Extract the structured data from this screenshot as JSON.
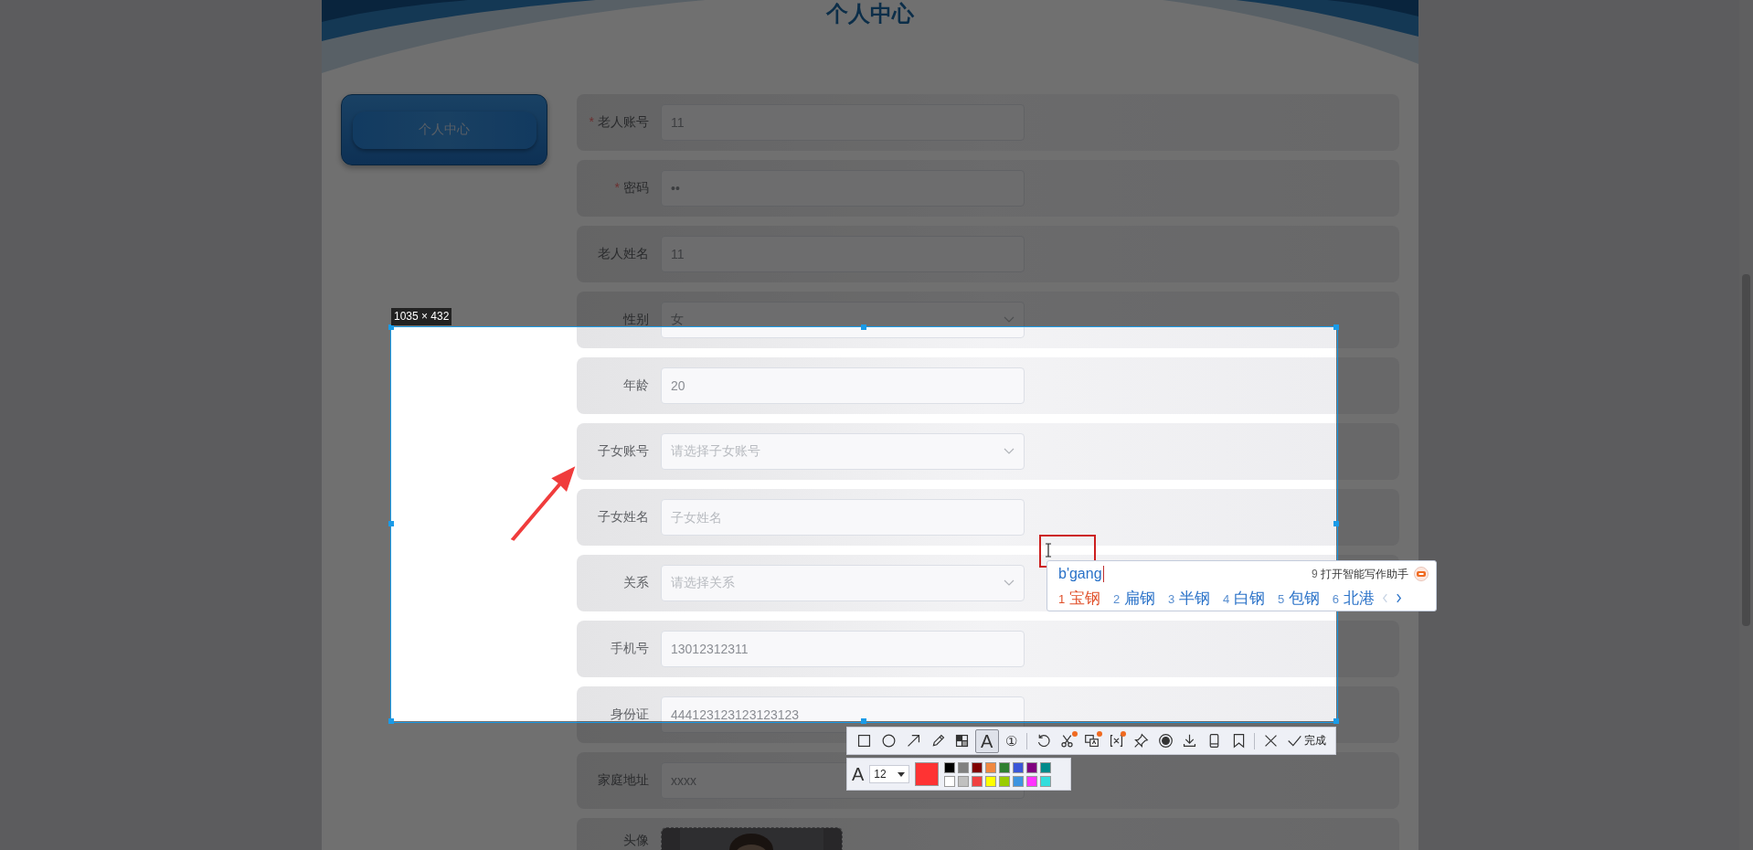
{
  "page": {
    "title": "个人中心"
  },
  "sidebar": {
    "items": [
      {
        "label": "个人中心",
        "selected": true
      }
    ]
  },
  "form": {
    "fields": [
      {
        "label": "老人账号",
        "required_mark": "*",
        "kind": "text",
        "value": "11"
      },
      {
        "label": "密码",
        "required_mark": "*",
        "kind": "text",
        "value": "••"
      },
      {
        "label": "老人姓名",
        "kind": "text",
        "value": "11"
      },
      {
        "label": "性别",
        "kind": "select",
        "value": "女"
      },
      {
        "label": "年龄",
        "kind": "text",
        "value": "20"
      },
      {
        "label": "子女账号",
        "kind": "select",
        "placeholder": "请选择子女账号"
      },
      {
        "label": "子女姓名",
        "kind": "text",
        "placeholder": "子女姓名"
      },
      {
        "label": "关系",
        "kind": "select",
        "placeholder": "请选择关系"
      },
      {
        "label": "手机号",
        "kind": "text",
        "value": "13012312311"
      },
      {
        "label": "身份证",
        "kind": "text",
        "value": "444123123123123123"
      },
      {
        "label": "家庭地址",
        "kind": "text",
        "value": "xxxx"
      },
      {
        "label": "头像",
        "kind": "picture"
      }
    ]
  },
  "capture": {
    "size_label": "1035 × 432"
  },
  "ime": {
    "input": "b'gang",
    "assistant": {
      "number": "9",
      "label": "打开智能写作助手"
    },
    "candidates": [
      {
        "number": "1",
        "text": "宝钢",
        "selected": true
      },
      {
        "number": "2",
        "text": "扁钢",
        "selected": false
      },
      {
        "number": "3",
        "text": "半钢",
        "selected": false
      },
      {
        "number": "4",
        "text": "白钢",
        "selected": false
      },
      {
        "number": "5",
        "text": "包钢",
        "selected": false
      },
      {
        "number": "6",
        "text": "北港",
        "selected": false
      }
    ],
    "pager": {
      "prev_disabled": true,
      "next_disabled": false
    }
  },
  "toolbar": {
    "groups": [
      {
        "tools": [
          {
            "kind": "square",
            "selected": false
          },
          {
            "kind": "circle",
            "selected": false
          },
          {
            "kind": "arrow",
            "selected": false
          },
          {
            "kind": "pencil",
            "selected": false
          },
          {
            "kind": "mosaic",
            "selected": false
          },
          {
            "kind": "text",
            "glyph": "A",
            "selected": true
          },
          {
            "kind": "number",
            "glyph": "①",
            "selected": false
          }
        ]
      },
      {
        "tools": [
          {
            "kind": "undo",
            "selected": false
          },
          {
            "kind": "scissors",
            "badge": true,
            "selected": false
          },
          {
            "kind": "translate",
            "badge": true,
            "selected": false
          },
          {
            "kind": "scan",
            "badge": true,
            "selected": false
          },
          {
            "kind": "pin",
            "selected": false
          },
          {
            "kind": "record",
            "selected": false
          },
          {
            "kind": "download",
            "selected": false
          },
          {
            "kind": "phone",
            "selected": false
          },
          {
            "kind": "bookmark",
            "selected": false
          }
        ]
      },
      {
        "tools": [
          {
            "kind": "close",
            "selected": false
          }
        ]
      }
    ],
    "done": "完成"
  },
  "text_options": {
    "glyph": "A",
    "font_size": "12",
    "current": {
      "color": "#ff3333"
    },
    "palette": [
      {
        "color": "#000000"
      },
      {
        "color": "#808080"
      },
      {
        "color": "#800000"
      },
      {
        "color": "#f08840"
      },
      {
        "color": "#2f8030"
      },
      {
        "color": "#3a56d8"
      },
      {
        "color": "#800080"
      },
      {
        "color": "#008b8b"
      },
      {
        "color": "#ffffff"
      },
      {
        "color": "#c0c0c0"
      },
      {
        "color": "#f04040"
      },
      {
        "color": "#ffff00"
      },
      {
        "color": "#99cc00"
      },
      {
        "color": "#3d94e0"
      },
      {
        "color": "#ff33ff"
      },
      {
        "color": "#33dddd"
      }
    ]
  }
}
